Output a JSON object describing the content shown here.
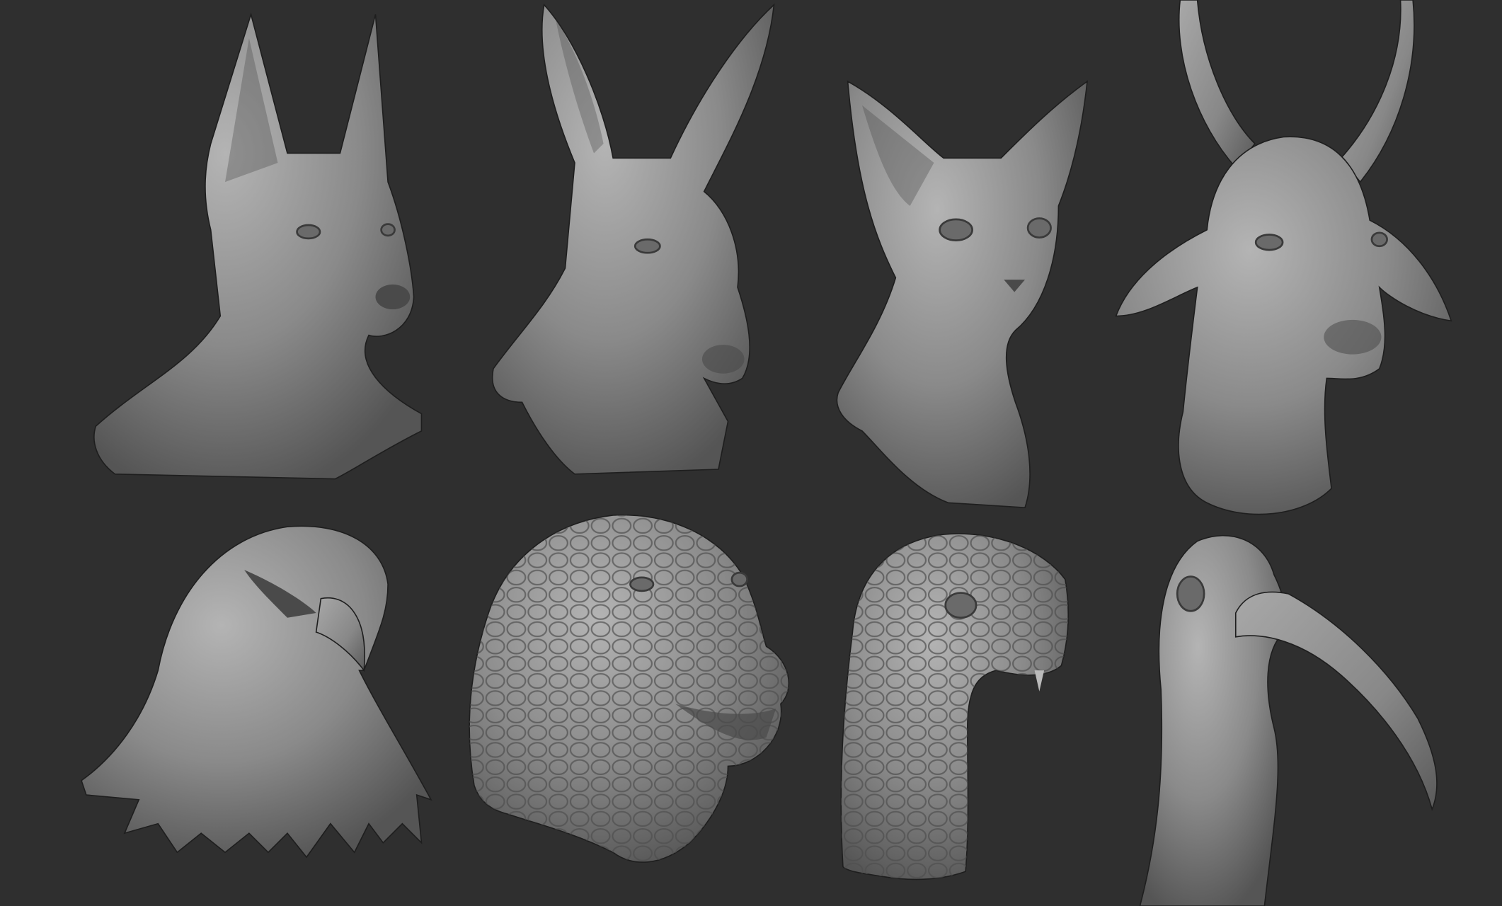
{
  "colors": {
    "background": "#2f2f2f",
    "clay_light": "#b4b4b4",
    "clay_mid": "#8a8a8a",
    "clay_dark": "#555555"
  },
  "sculpts": [
    {
      "subject": "jackal",
      "icon": "jackal-head"
    },
    {
      "subject": "donkey",
      "icon": "donkey-head"
    },
    {
      "subject": "cat",
      "icon": "cat-head"
    },
    {
      "subject": "bull",
      "icon": "bull-head"
    },
    {
      "subject": "falcon",
      "icon": "falcon-head"
    },
    {
      "subject": "crocodile",
      "icon": "crocodile-head"
    },
    {
      "subject": "cobra",
      "icon": "snake-head"
    },
    {
      "subject": "ibis",
      "icon": "ibis-head"
    }
  ]
}
